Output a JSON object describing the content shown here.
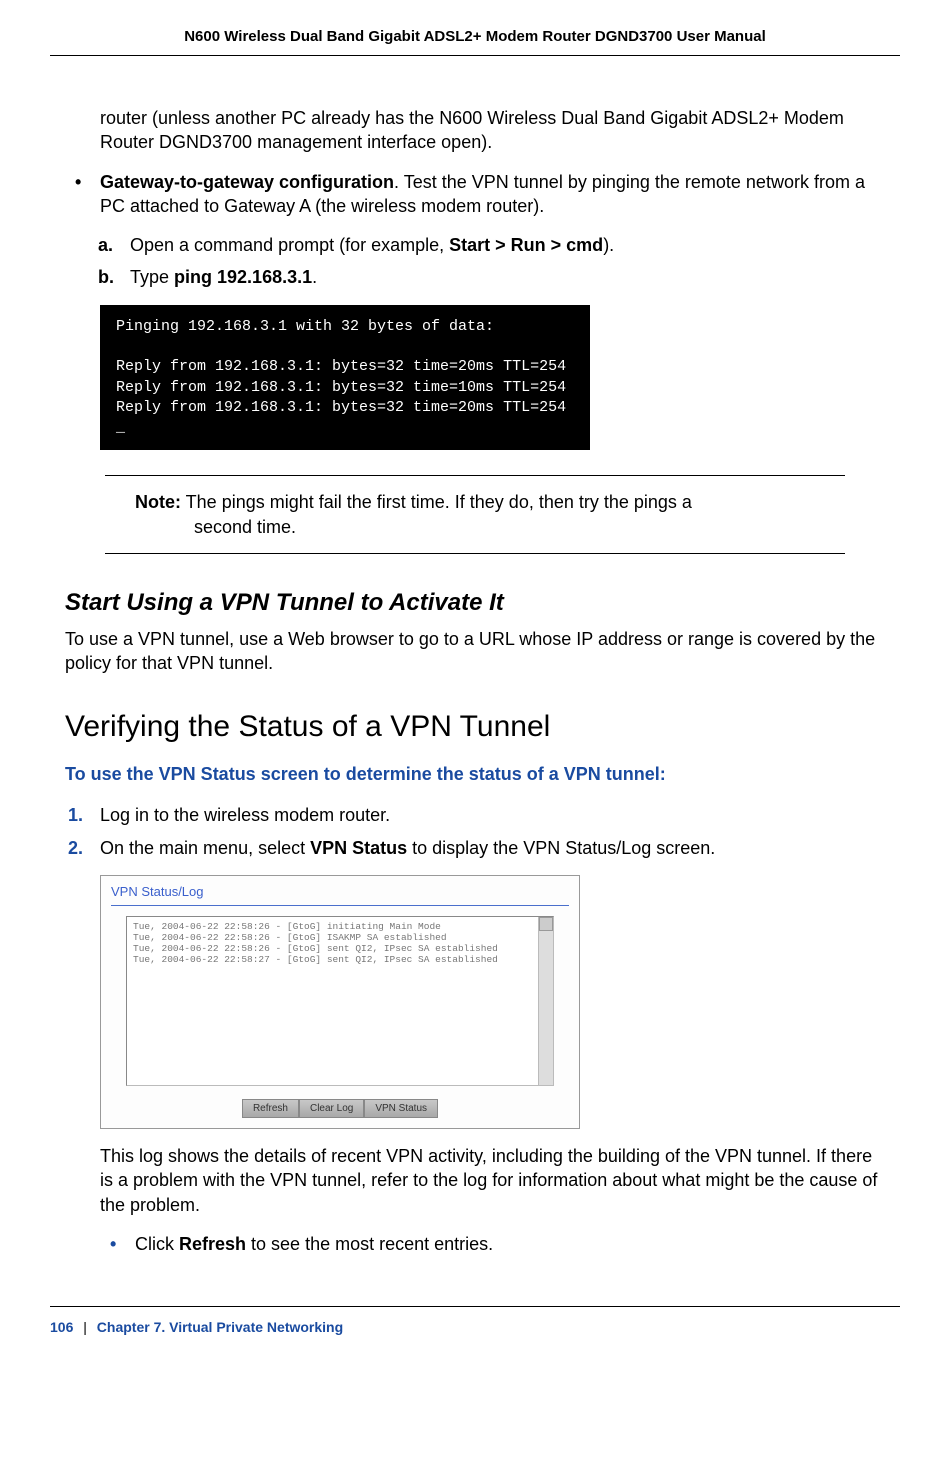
{
  "header": {
    "title": "N600 Wireless Dual Band Gigabit ADSL2+ Modem Router DGND3700 User Manual"
  },
  "para_continued": {
    "text_before": "router (unless another PC already has the N600 Wireless Dual Band Gigabit ADSL2+ Modem Router DGND3700 management interface open)."
  },
  "bullet_gateway": {
    "bold": "Gateway-to-gateway configuration",
    "rest": ". Test the VPN tunnel by pinging the remote network from a PC attached to Gateway A (the wireless modem router)."
  },
  "step_a": {
    "marker": "a.",
    "before": "Open a command prompt (for example, ",
    "bold": "Start > Run > cmd",
    "after": ")."
  },
  "step_b": {
    "marker": "b.",
    "before": "Type ",
    "bold": "ping 192.168.3.1",
    "after": "."
  },
  "cmd_output": "Pinging 192.168.3.1 with 32 bytes of data:\n\nReply from 192.168.3.1: bytes=32 time=20ms TTL=254\nReply from 192.168.3.1: bytes=32 time=10ms TTL=254\nReply from 192.168.3.1: bytes=32 time=20ms TTL=254\n_",
  "note": {
    "label": "Note:",
    "line1": "  The pings might fail the first time. If they do, then try the pings a",
    "line2": "second time."
  },
  "subsection1": {
    "heading": "Start Using a VPN Tunnel to Activate It",
    "para": "To use a VPN tunnel, use a Web browser to go to a URL whose IP address or range is covered by the policy for that VPN tunnel."
  },
  "section2": {
    "heading": "Verifying the Status of a VPN Tunnel",
    "procedure_intro": "To use the VPN Status screen to determine the status of a VPN tunnel:"
  },
  "step1": {
    "num": "1.",
    "text": "Log in to the wireless modem router."
  },
  "step2": {
    "num": "2.",
    "before": "On the main menu, select ",
    "bold": "VPN Status",
    "after": " to display the VPN Status/Log screen."
  },
  "vpn_screenshot": {
    "title": "VPN Status/Log",
    "log": "Tue, 2004-06-22 22:58:26 - [GtoG] initiating Main Mode\nTue, 2004-06-22 22:58:26 - [GtoG] ISAKMP SA established\nTue, 2004-06-22 22:58:26 - [GtoG] sent QI2, IPsec SA established\nTue, 2004-06-22 22:58:27 - [GtoG] sent QI2, IPsec SA established",
    "buttons": {
      "refresh": "Refresh",
      "clearlog": "Clear Log",
      "vpnstatus": "VPN Status"
    }
  },
  "after_vpn_para": "This log shows the details of recent VPN activity, including the building of the VPN tunnel. If there is a problem with the VPN tunnel, refer to the log for information about what might be the cause of the problem.",
  "sub_bullet": {
    "before": "Click ",
    "bold": "Refresh",
    "after": " to see the most recent entries."
  },
  "footer": {
    "page": "106",
    "sep": "|",
    "chapter": "Chapter 7.  Virtual Private Networking"
  }
}
